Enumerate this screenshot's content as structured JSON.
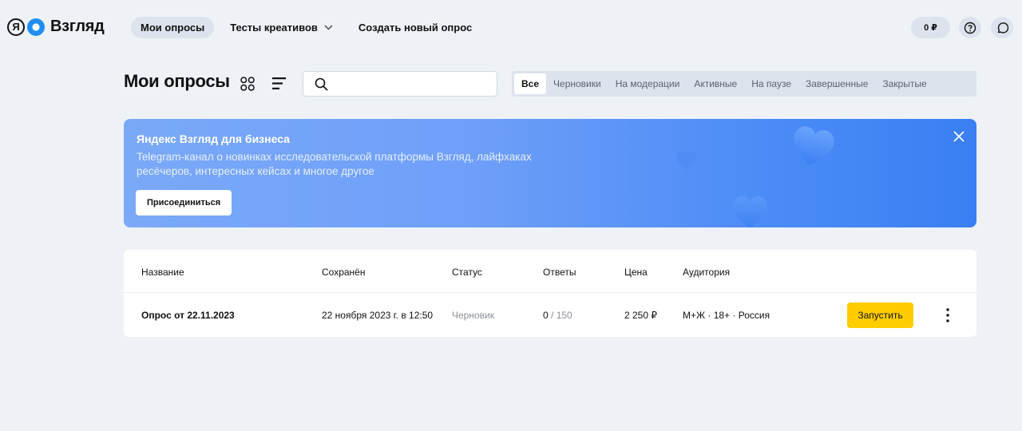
{
  "header": {
    "logo_ya": "Я",
    "logo_text": "Взгляд",
    "nav": [
      {
        "label": "Мои опросы",
        "active": true
      },
      {
        "label": "Тесты креативов",
        "has_dropdown": true
      },
      {
        "label": "Создать новый опрос"
      }
    ],
    "balance": "0 ₽",
    "icons": [
      "help-icon",
      "chat-icon"
    ]
  },
  "main": {
    "title": "Мои опросы",
    "search": {
      "value": "",
      "placeholder": ""
    },
    "filters": [
      {
        "label": "Все",
        "active": true
      },
      {
        "label": "Черновики"
      },
      {
        "label": "На модерации"
      },
      {
        "label": "Активные"
      },
      {
        "label": "На паузе"
      },
      {
        "label": "Завершенные"
      },
      {
        "label": "Закрытые"
      }
    ]
  },
  "banner": {
    "title": "Яндекс Взгляд для бизнеса",
    "text": "Telegram-канал о новинках исследовательской платформы Взгляд, лайфхаках ресёчеров, интересных кейсах и многое другое",
    "button": "Присоединиться"
  },
  "table": {
    "columns": [
      "Название",
      "Сохранён",
      "Статус",
      "Ответы",
      "Цена",
      "Аудитория"
    ],
    "rows": [
      {
        "name": "Опрос от 22.11.2023",
        "saved": "22 ноября 2023 г. в 12:50",
        "status": "Черновик",
        "answers_done": "0",
        "answers_total": " / 150",
        "price": "2 250 ₽",
        "audience": "М+Ж · 18+ · Россия",
        "action": "Запустить"
      }
    ]
  },
  "colors": {
    "background": "#eef2f7",
    "accent_yellow": "#ffcc00",
    "banner_blue": "#4b8cf6"
  }
}
